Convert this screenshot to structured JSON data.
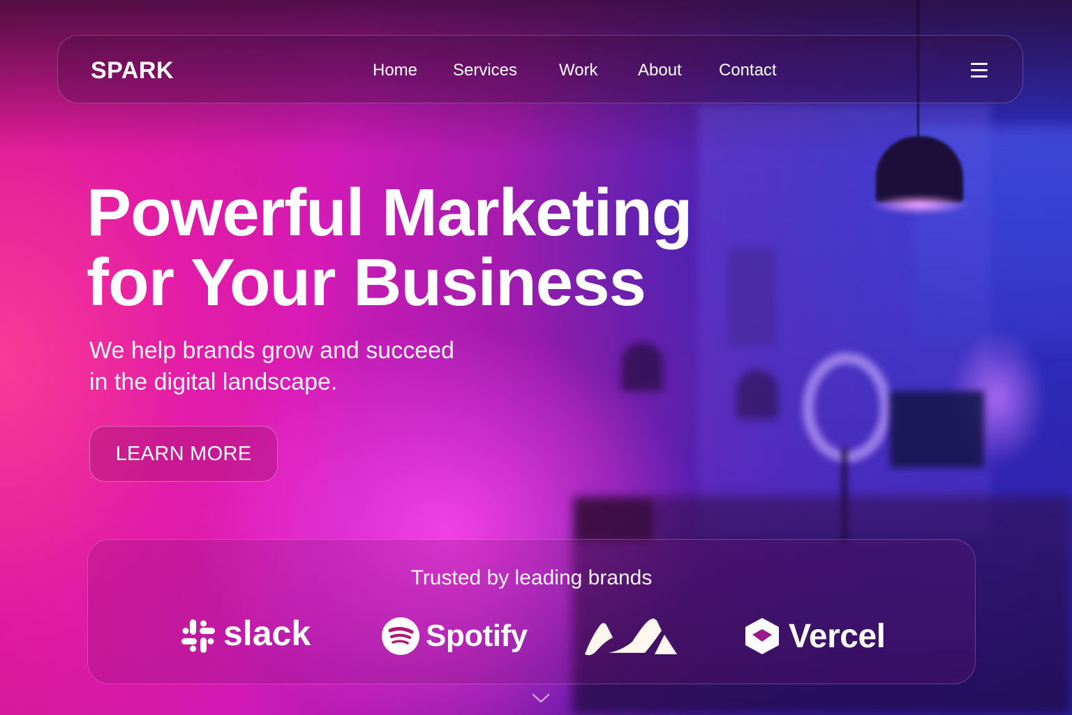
{
  "nav": {
    "logo": "SPARK",
    "links": [
      "Home",
      "Services",
      "Work",
      "About",
      "Contact"
    ],
    "menu_icon": "hamburger-menu-icon"
  },
  "hero": {
    "title_line1": "Powerful Marketing",
    "title_line2": "for Your Business",
    "subtitle_line1": "We help brands grow and succeed",
    "subtitle_line2": "in the digital landscape.",
    "cta_label": "LEARN MORE"
  },
  "trusted": {
    "title": "Trusted by leading brands",
    "brands": [
      {
        "name": "slack",
        "icon": "slack-logo-icon"
      },
      {
        "name": "Spotify",
        "icon": "spotify-logo-icon"
      },
      {
        "name": "",
        "icon": "mountain-peaks-logo-icon"
      },
      {
        "name": "Vercel",
        "icon": "vercel-logo-icon"
      }
    ]
  },
  "scroll_icon": "chevron-down-icon",
  "colors": {
    "accent_pink": "#e01ac8",
    "accent_blue": "#2b2fb0",
    "text": "#ffffff"
  }
}
